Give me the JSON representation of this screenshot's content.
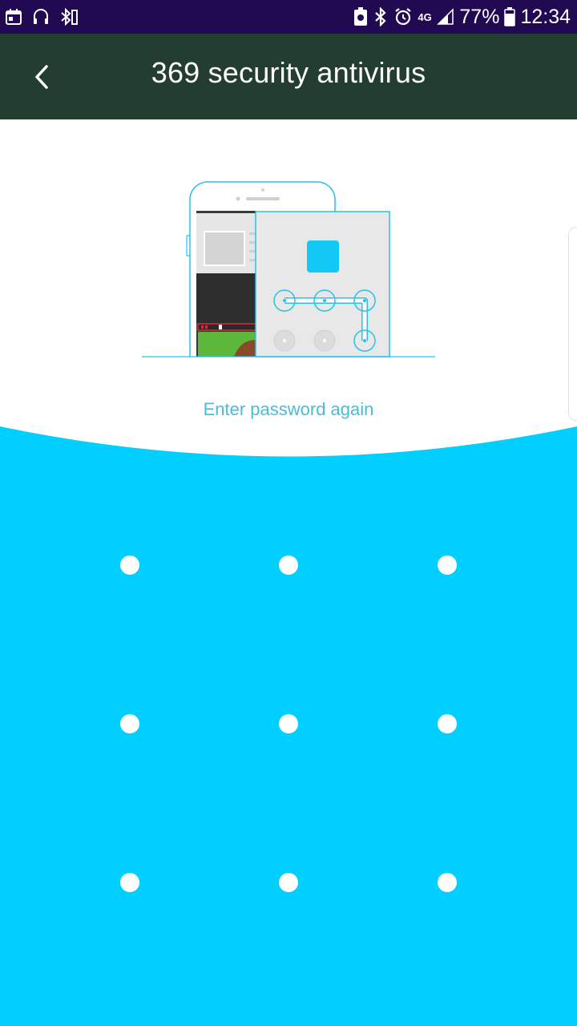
{
  "status_bar": {
    "battery_percent": "77%",
    "time": "12:34",
    "network": "4G",
    "icons": [
      "calendar-icon",
      "headset-icon",
      "bluetooth-battery-icon",
      "battery-saver-icon",
      "bluetooth-icon",
      "alarm-icon",
      "network-4g-icon",
      "signal-icon",
      "battery-icon"
    ]
  },
  "toolbar": {
    "title": "369 security antivirus",
    "back_icon": "chevron-left-icon"
  },
  "illustration": {
    "description_icon": "phone-pattern-lock-illustration"
  },
  "prompt": "Enter password again",
  "pattern_lock": {
    "rows": 3,
    "cols": 3,
    "dots": 9
  },
  "colors": {
    "status_bar": "#220a52",
    "toolbar": "#233e30",
    "accent": "#00cfff",
    "prompt_text": "#4dbad8"
  }
}
